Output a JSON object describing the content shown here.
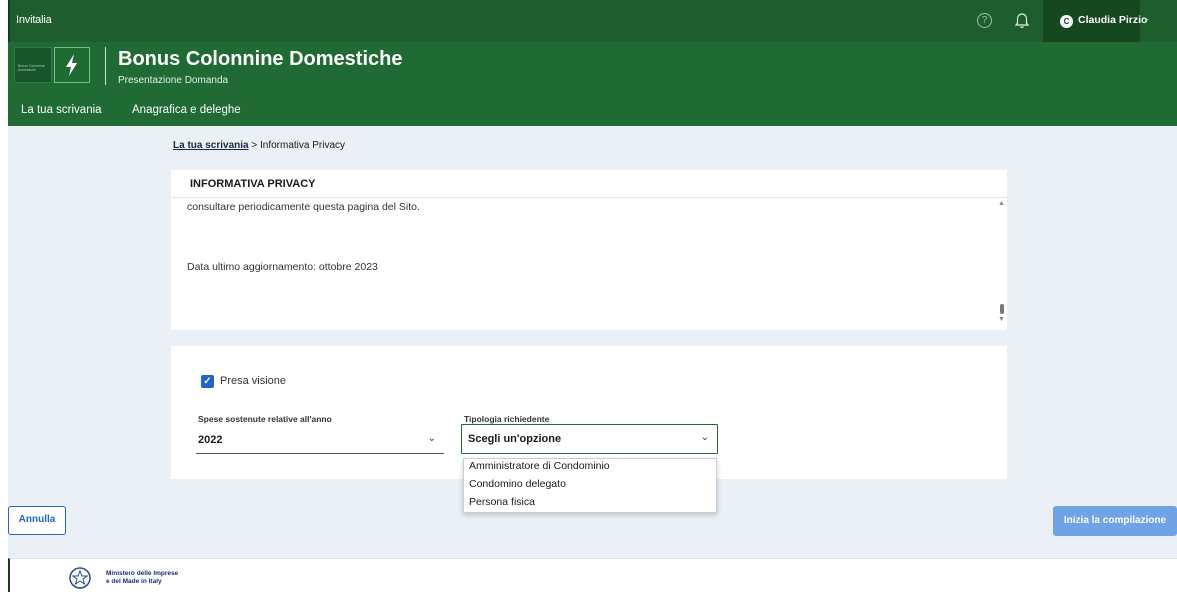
{
  "topbar": {
    "brand": "Invitalia",
    "help_icon": "question-circle-icon",
    "notification_icon": "bell-icon",
    "user": {
      "initial": "C",
      "name": "Claudia Pirzio",
      "chevron": "chevron-down-icon"
    }
  },
  "header": {
    "logo_text": "Bonus Colonnine domestiche",
    "title": "Bonus Colonnine Domestiche",
    "subtitle": "Presentazione Domanda",
    "nav": [
      {
        "label": "La tua scrivania"
      },
      {
        "label": "Anagrafica e deleghe"
      }
    ]
  },
  "breadcrumb": {
    "home": "La tua scrivania",
    "separator": ">",
    "current": "Informativa Privacy"
  },
  "privacy": {
    "heading": "INFORMATIVA PRIVACY",
    "lines": [
      "consultare periodicamente questa pagina del Sito.",
      "Data ultimo aggiornamento: ottobre 2023"
    ]
  },
  "form": {
    "checkbox": {
      "label": "Presa visione",
      "checked": true
    },
    "year_field": {
      "label": "Spese sostenute relative all'anno",
      "value": "2022"
    },
    "type_field": {
      "label": "Tipologia richiedente",
      "value": "Scegli un'opzione",
      "options": [
        "Amministratore di Condominio",
        "Condomino delegato",
        "Persona fisica"
      ]
    }
  },
  "actions": {
    "cancel": "Annulla",
    "start": "Inizia la compilazione"
  },
  "footer": {
    "ministry_line1": "Ministero delle Imprese",
    "ministry_line2": "e del Made in Italy"
  },
  "colors": {
    "header_green": "#1f6b33",
    "topbar_green": "#1d5e2c",
    "primary_blue": "#1e66cc",
    "disabled_blue": "#6fa3e6",
    "background": "#eaf0f5"
  }
}
